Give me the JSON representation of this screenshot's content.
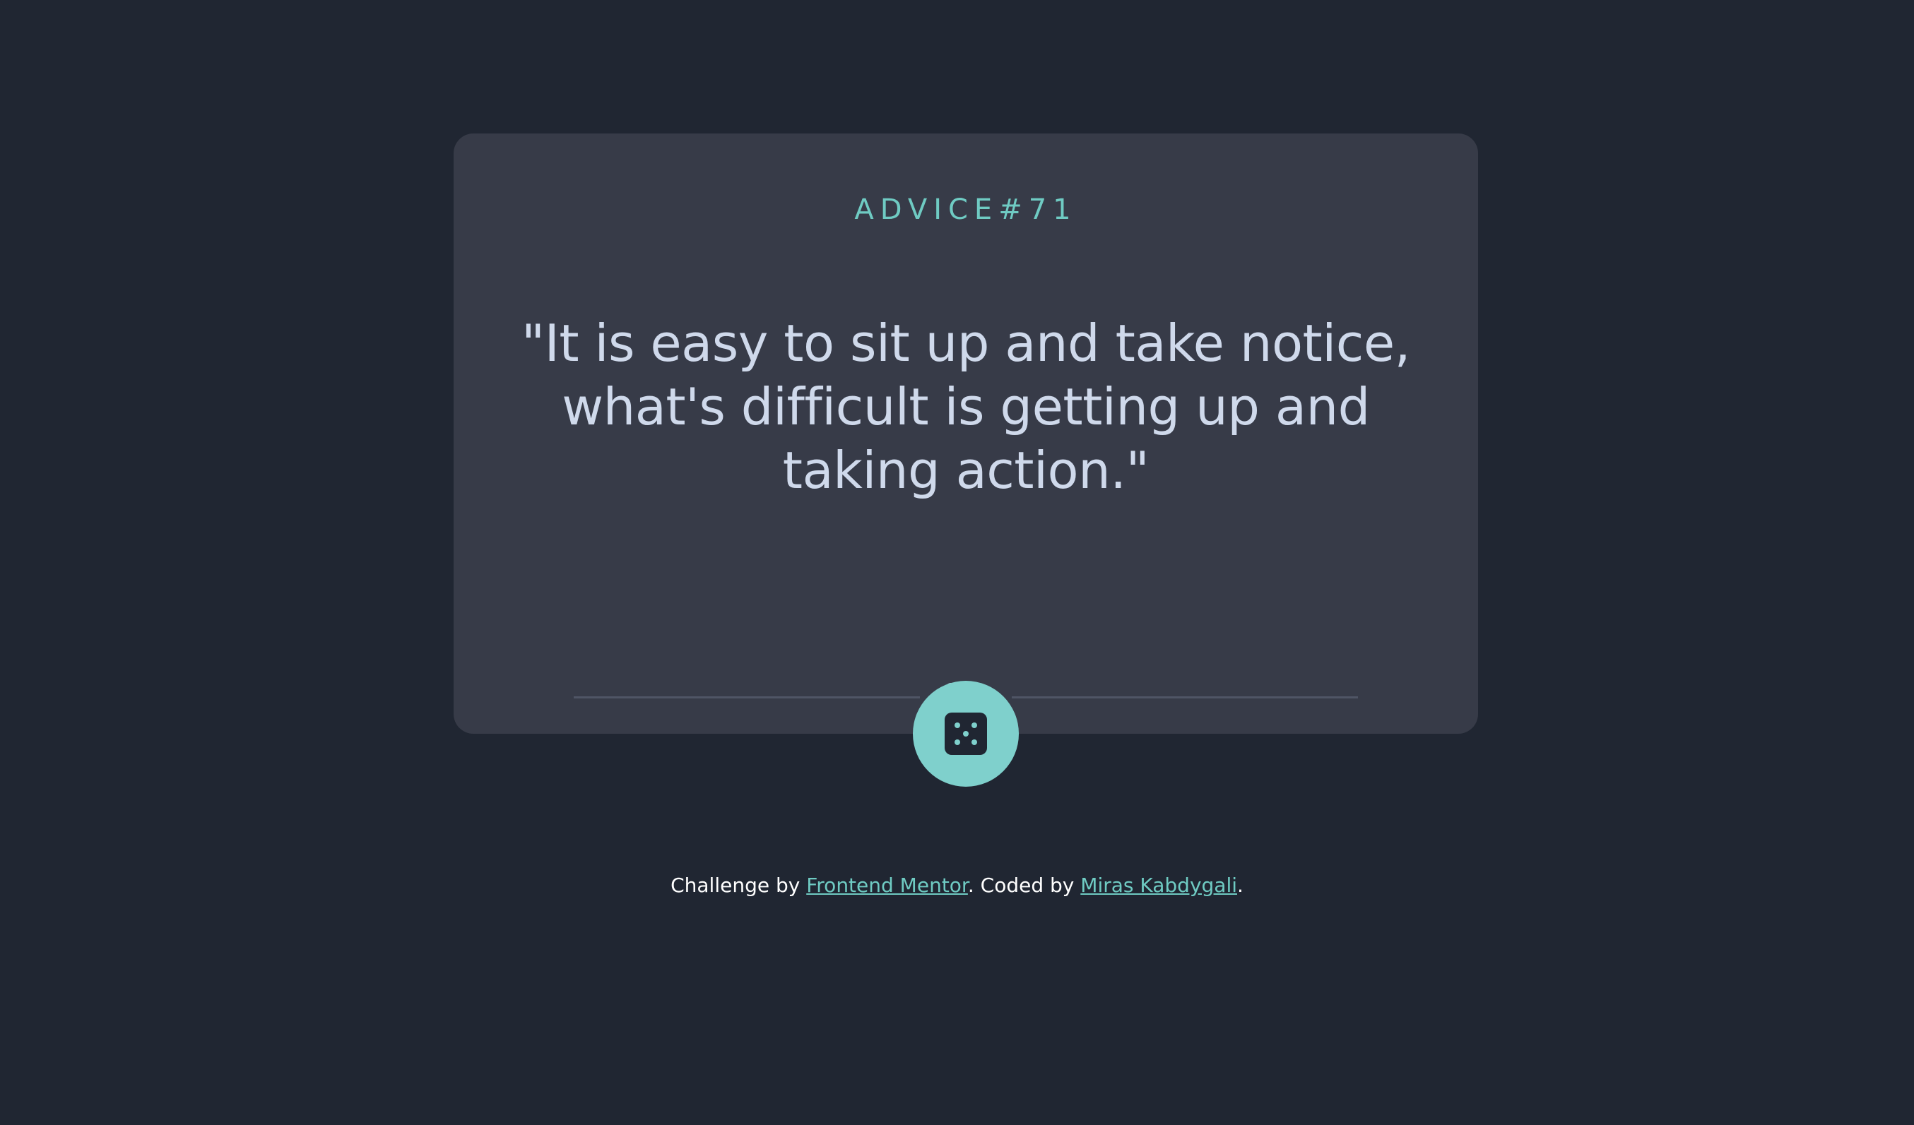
{
  "card": {
    "advice_id": "ADVICE#71",
    "quote": "\"It is easy to sit up and take notice, what's difficult is getting up and taking action.\""
  },
  "dice_button": {
    "icon": "dice-icon"
  },
  "footer": {
    "prefix": "Challenge by ",
    "link1": "Frontend Mentor",
    "middle": ". Coded by ",
    "link2": "Miras Kabdygali",
    "suffix": "."
  },
  "colors": {
    "background": "#202632",
    "card": "#373b48",
    "accent": "#6fcbc3",
    "text": "#cfd9eb"
  }
}
